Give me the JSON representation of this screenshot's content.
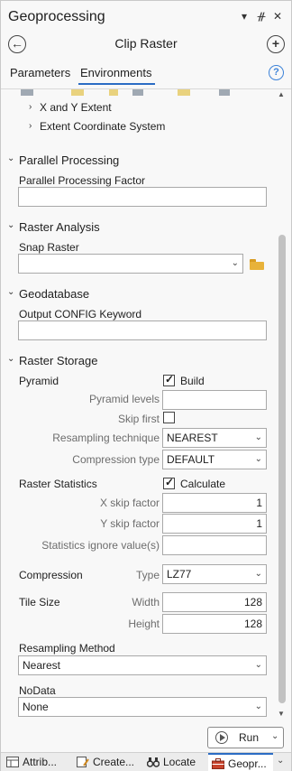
{
  "pane": {
    "title": "Geoprocessing",
    "title_icons": [
      "chevron-down-icon",
      "pin-icon",
      "close-icon"
    ],
    "tool_title": "Clip Raster"
  },
  "tabs": [
    {
      "label": "Parameters",
      "active": false
    },
    {
      "label": "Environments",
      "active": true
    }
  ],
  "extent_items": [
    "X and Y Extent",
    "Extent Coordinate System"
  ],
  "parallel": {
    "header": "Parallel Processing",
    "factor_label": "Parallel Processing Factor",
    "factor_value": ""
  },
  "raster_analysis": {
    "header": "Raster Analysis",
    "snap_label": "Snap Raster",
    "snap_value": ""
  },
  "geodatabase": {
    "header": "Geodatabase",
    "config_label": "Output CONFIG Keyword",
    "config_value": ""
  },
  "raster_storage": {
    "header": "Raster Storage",
    "pyramid_label": "Pyramid",
    "build_label": "Build",
    "build_checked": true,
    "pyramid_levels_label": "Pyramid levels",
    "pyramid_levels_value": "",
    "skip_first_label": "Skip first",
    "skip_first_checked": false,
    "resampling_technique_label": "Resampling technique",
    "resampling_technique_value": "NEAREST",
    "compression_type_label": "Compression type",
    "compression_type_value": "DEFAULT",
    "stats_label": "Raster Statistics",
    "calculate_label": "Calculate",
    "calculate_checked": true,
    "x_skip_label": "X skip factor",
    "x_skip_value": "1",
    "y_skip_label": "Y skip factor",
    "y_skip_value": "1",
    "ignore_label": "Statistics ignore value(s)",
    "ignore_value": "",
    "compression_label": "Compression",
    "type_label": "Type",
    "type_value": "LZ77",
    "tile_size_label": "Tile Size",
    "width_label": "Width",
    "width_value": "128",
    "height_label": "Height",
    "height_value": "128",
    "resampling_method_label": "Resampling Method",
    "resampling_method_value": "Nearest",
    "nodata_label": "NoData",
    "nodata_value": "None"
  },
  "run_button": {
    "label": "Run"
  },
  "bottom_tabs": [
    {
      "label": "Attrib...",
      "icon": "table-icon",
      "active": false
    },
    {
      "label": "Create...",
      "icon": "create-features-icon",
      "active": false
    },
    {
      "label": "Locate",
      "icon": "binoculars-icon",
      "active": false
    },
    {
      "label": "Geopr...",
      "icon": "toolbox-icon",
      "active": true
    }
  ]
}
